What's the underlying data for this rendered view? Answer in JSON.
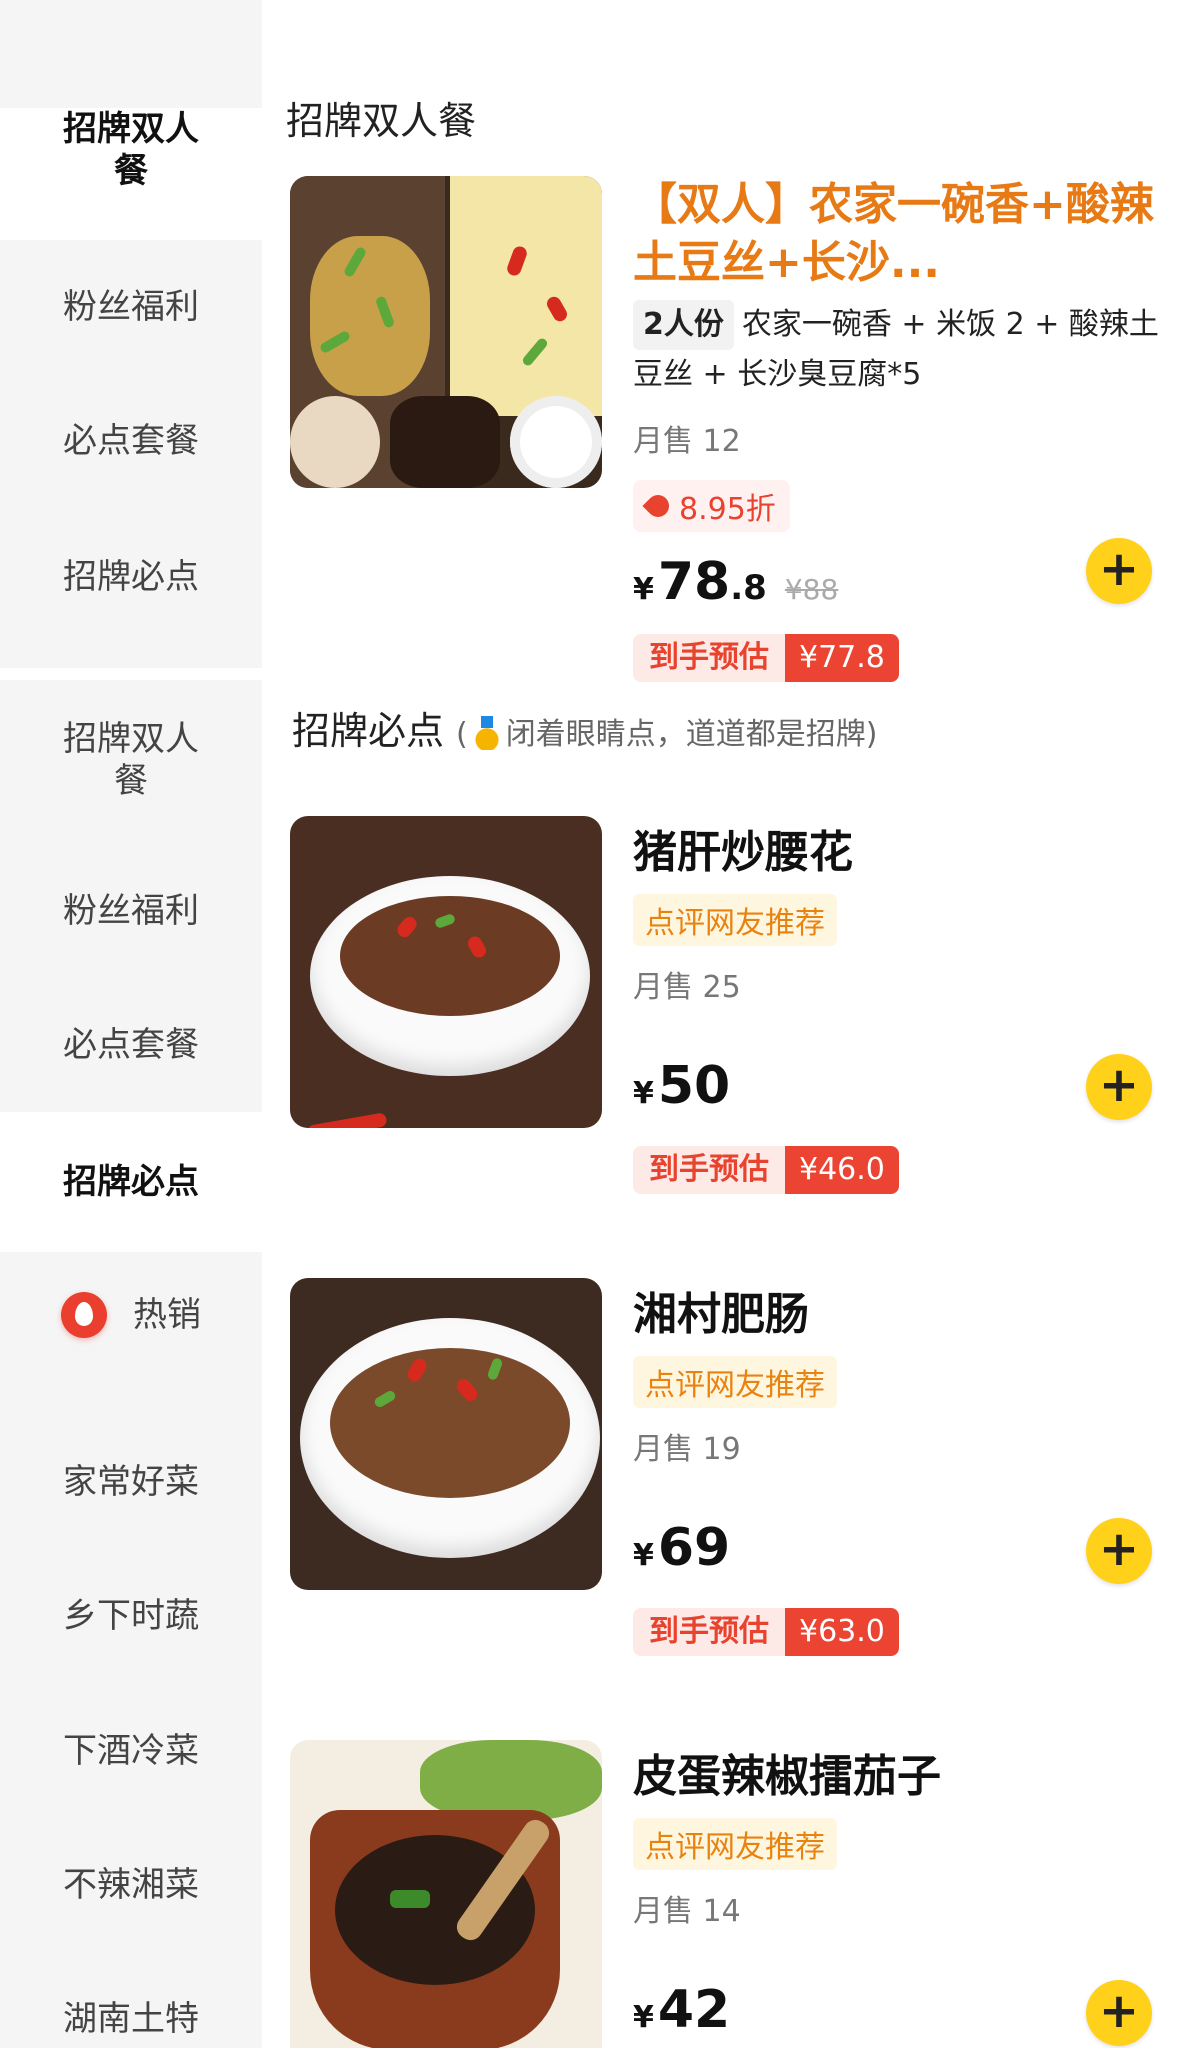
{
  "sidebar_top": {
    "items": [
      {
        "label": "招牌双人餐",
        "active": true
      },
      {
        "label": "粉丝福利",
        "active": false
      },
      {
        "label": "必点套餐",
        "active": false
      },
      {
        "label": "招牌必点",
        "active": false
      }
    ]
  },
  "sidebar_bottom": {
    "items": [
      {
        "label": "招牌双人餐",
        "active": false
      },
      {
        "label": "粉丝福利",
        "active": false
      },
      {
        "label": "必点套餐",
        "active": false
      },
      {
        "label": "招牌必点",
        "active": true
      },
      {
        "label": "热销",
        "active": false,
        "icon": "fire-icon"
      },
      {
        "label": "家常好菜",
        "active": false
      },
      {
        "label": "乡下时蔬",
        "active": false
      },
      {
        "label": "下酒冷菜",
        "active": false
      },
      {
        "label": "不辣湘菜",
        "active": false
      },
      {
        "label": "湖南土特",
        "active": false
      }
    ]
  },
  "section1": {
    "title": "招牌双人餐"
  },
  "combo": {
    "name": "【双人】农家一碗香+酸辣土豆丝+长沙...",
    "serving": "2人份",
    "description": "农家一碗香 + 米饭 2 + 酸辣土豆丝 + 长沙臭豆腐*5",
    "sales": "月售 12",
    "discount": "8.95折",
    "currency": "¥",
    "price_int": "78",
    "price_dec": ".8",
    "original_price": "¥88",
    "est_label": "到手预估",
    "est_price": "¥77.8"
  },
  "section2": {
    "title": "招牌必点",
    "subtitle_open": "(",
    "subtitle": "闭着眼睛点，道道都是招牌)"
  },
  "products": [
    {
      "name": "猪肝炒腰花",
      "tag": "点评网友推荐",
      "sales": "月售 25",
      "currency": "¥",
      "price": "50",
      "est_label": "到手预估",
      "est_price": "¥46.0"
    },
    {
      "name": "湘村肥肠",
      "tag": "点评网友推荐",
      "sales": "月售 19",
      "currency": "¥",
      "price": "69",
      "est_label": "到手预估",
      "est_price": "¥63.0"
    },
    {
      "name": "皮蛋辣椒擂茄子",
      "tag": "点评网友推荐",
      "sales": "月售 14",
      "currency": "¥",
      "price": "42"
    }
  ],
  "add_label": "+",
  "colors": {
    "accent_orange": "#e77a14",
    "add_button": "#ffd11a",
    "est_red": "#ec4432",
    "sidebar_bg": "#f5f5f6"
  }
}
